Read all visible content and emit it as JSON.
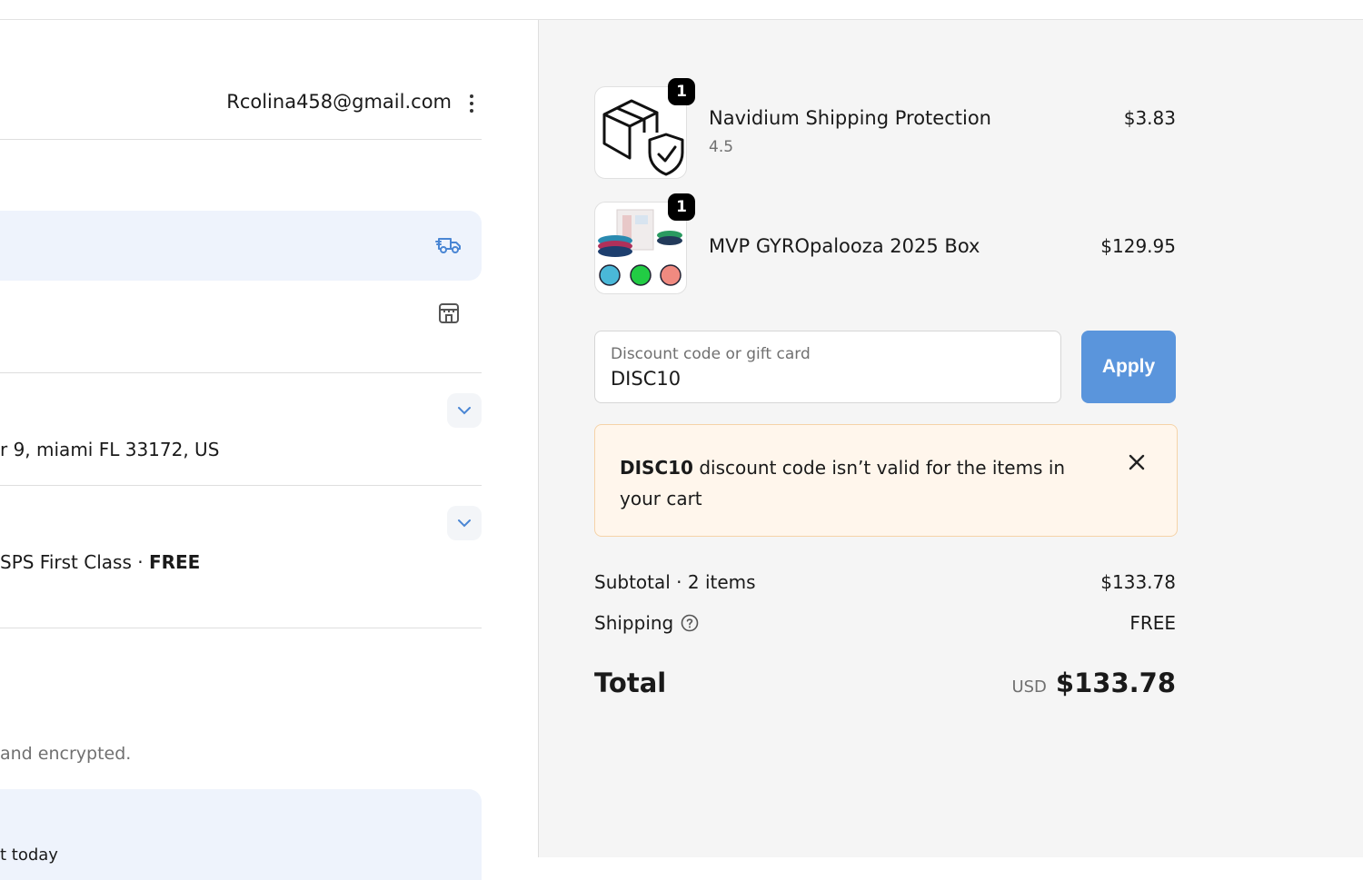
{
  "contact": {
    "email": "Rcolina458@gmail.com"
  },
  "delivery": {
    "ship_icon": "delivery-truck-icon",
    "pickup_icon": "store-icon"
  },
  "ship_to": {
    "address": "r 9, miami FL 33172, US"
  },
  "shipping_method": {
    "name": "SPS First Class · ",
    "price": "FREE"
  },
  "payment": {
    "note": "and encrypted.",
    "partial": "t today"
  },
  "items": [
    {
      "name": "Navidium Shipping Protection",
      "variant": "4.5",
      "price": "$3.83",
      "quantity": "1",
      "image_icon": "package-shield-icon"
    },
    {
      "name": "MVP GYROpalooza 2025 Box",
      "variant": "",
      "price": "$129.95",
      "quantity": "1",
      "image_icon": "disc-golf-box-icon"
    }
  ],
  "discount": {
    "label": "Discount code or gift card",
    "value": "DISC10",
    "apply_label": "Apply"
  },
  "error": {
    "code": "DISC10",
    "message": " discount code isn’t valid for the items in your cart"
  },
  "summary": {
    "subtotal_label": "Subtotal · 2 items",
    "subtotal_value": "$133.78",
    "shipping_label": "Shipping",
    "shipping_value": "FREE",
    "total_label": "Total",
    "currency": "USD",
    "total_value": "$133.78"
  },
  "colors": {
    "accent": "#5a95dc",
    "error_bg": "#fff6ec",
    "panel_bg": "#f5f5f5"
  }
}
